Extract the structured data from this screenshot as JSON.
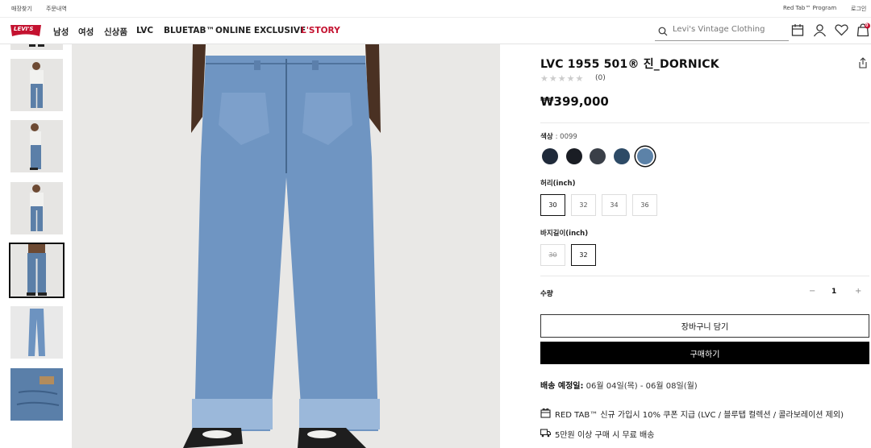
{
  "util": {
    "store_finder": "매장찾기",
    "order_history": "주문내역",
    "red_tab_program": "Red Tab™ Program",
    "login": "로그인"
  },
  "nav": {
    "logo_text": "LEVI'S",
    "items": [
      "남성",
      "여성",
      "신상품",
      "LVC",
      "BLUETAB™",
      "ONLINE EXCLUSIVE",
      "L'STORY"
    ],
    "highlight_color": "#c41230"
  },
  "search": {
    "placeholder": "Levi's Vintage Clothing"
  },
  "cart": {
    "count": "0"
  },
  "product": {
    "title": "LVC 1955 501® 진_DORNICK",
    "stars": "★★★★★",
    "review_count": "(0)",
    "price": "₩399,000",
    "color_label": "색상",
    "color_value": ": 0099",
    "swatches": [
      "#1f2a3a",
      "#1a1d24",
      "#3a3f48",
      "#2d4a66",
      "#5c82a8"
    ],
    "waist_label": "허리(inch)",
    "waist_sizes": [
      "30",
      "32",
      "34",
      "36"
    ],
    "length_label": "바지길이(inch)",
    "length_sizes": [
      "30",
      "32"
    ],
    "qty_label": "수량",
    "qty_minus": "−",
    "qty_value": "1",
    "qty_plus": "+",
    "add_to_cart": "장바구니 담기",
    "buy_now": "구매하기",
    "shipping_label": "배송 예정일:",
    "shipping_dates": "06월 04일(목) - 06월 08일(월)",
    "promo1": "RED TAB™ 신규 가입시 10% 쿠폰 지급 (LVC / 블루탭 컬렉션 / 콜라보레이션 제외)",
    "promo2": "5만원 이상 구매 시 무료 배송"
  }
}
